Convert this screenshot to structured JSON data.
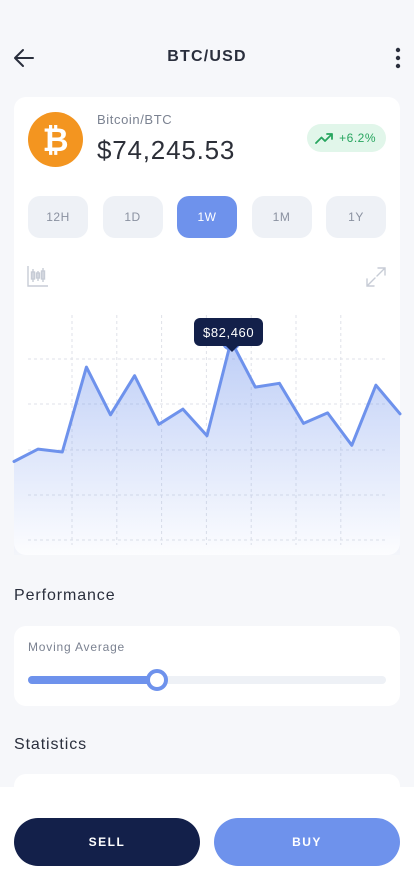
{
  "header": {
    "title": "BTC/USD",
    "back_icon": "arrow-left-icon",
    "more_icon": "more-vertical-icon"
  },
  "coin": {
    "subtitle": "Bitcoin/BTC",
    "price": "$74,245.53",
    "change": "+6.2%",
    "change_icon": "trending-up-icon",
    "symbol_glyph": "₿",
    "colors": {
      "brand": "#f39520",
      "positive": "#27a55f"
    }
  },
  "periods": [
    {
      "label": "12H",
      "active": false
    },
    {
      "label": "1D",
      "active": false
    },
    {
      "label": "1W",
      "active": true
    },
    {
      "label": "1M",
      "active": false
    },
    {
      "label": "1Y",
      "active": false
    }
  ],
  "chart": {
    "tooltip": "$82,460",
    "tools": [
      "candlestick-icon",
      "expand-icon"
    ],
    "accent": "#6e92ec"
  },
  "chart_data": {
    "type": "area",
    "series": [
      {
        "values": [
          69800,
          71100,
          70800,
          79700,
          74700,
          78800,
          73700,
          75300,
          72500,
          82460,
          77600,
          78000,
          73800,
          74900,
          71500,
          77800,
          74800
        ]
      }
    ],
    "highlight_index": 9,
    "ylim": [
      60000,
      86000
    ],
    "grid": true
  },
  "performance": {
    "title": "Performance",
    "label": "Moving Average",
    "value": 0.36
  },
  "statistics": {
    "title": "Statistics"
  },
  "actions": {
    "sell": "SELL",
    "buy": "BUY"
  }
}
